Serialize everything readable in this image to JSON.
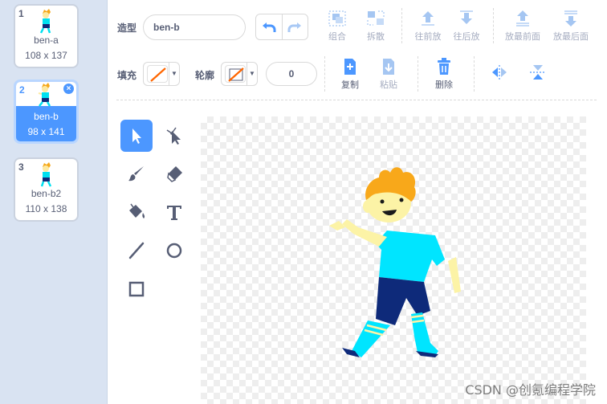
{
  "costumes": [
    {
      "number": "1",
      "name": "ben-a",
      "size": "108 x 137"
    },
    {
      "number": "2",
      "name": "ben-b",
      "size": "98 x 141"
    },
    {
      "number": "3",
      "name": "ben-b2",
      "size": "110 x 138"
    }
  ],
  "toolbar": {
    "costume_label": "造型",
    "costume_name": "ben-b",
    "group_label": "组合",
    "ungroup_label": "拆散",
    "forward_label": "往前放",
    "backward_label": "往后放",
    "front_label": "放最前面",
    "back_label": "放最后面",
    "fill_label": "填充",
    "outline_label": "轮廓",
    "outline_width": "0",
    "copy_label": "复制",
    "paste_label": "粘贴",
    "delete_label": "删除"
  },
  "colors": {
    "accent": "#4c97ff",
    "fill": "#ff6600",
    "outline": "#ff6600",
    "delete": "#855cd6"
  },
  "watermark": "CSDN @创氪编程学院"
}
